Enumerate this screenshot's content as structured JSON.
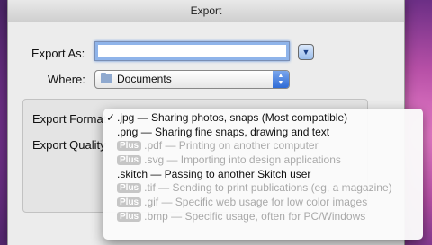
{
  "window": {
    "title": "Export"
  },
  "form": {
    "export_as_label": "Export As:",
    "export_as_value": "",
    "where_label": "Where:",
    "where_value": "Documents",
    "format_label": "Export Format",
    "quality_label": "Export Quality"
  },
  "menu": {
    "items": [
      {
        "text": ".jpg — Sharing photos, snaps (Most compatible)",
        "checked": true,
        "enabled": true,
        "plus": false
      },
      {
        "text": ".png — Sharing fine snaps, drawing and text",
        "checked": false,
        "enabled": true,
        "plus": false
      },
      {
        "text": ".pdf — Printing on another computer",
        "checked": false,
        "enabled": false,
        "plus": true
      },
      {
        "text": ".svg — Importing into design applications",
        "checked": false,
        "enabled": false,
        "plus": true
      },
      {
        "text": ".skitch — Passing to another Skitch user",
        "checked": false,
        "enabled": true,
        "plus": false
      },
      {
        "text": ".tif — Sending to print publications (eg, a magazine)",
        "checked": false,
        "enabled": false,
        "plus": true
      },
      {
        "text": ".gif — Specific web usage for low color images",
        "checked": false,
        "enabled": false,
        "plus": true
      },
      {
        "text": ".bmp — Specific usage, often for PC/Windows",
        "checked": false,
        "enabled": false,
        "plus": true
      }
    ],
    "plus_badge": "Plus",
    "check_glyph": "✓"
  }
}
